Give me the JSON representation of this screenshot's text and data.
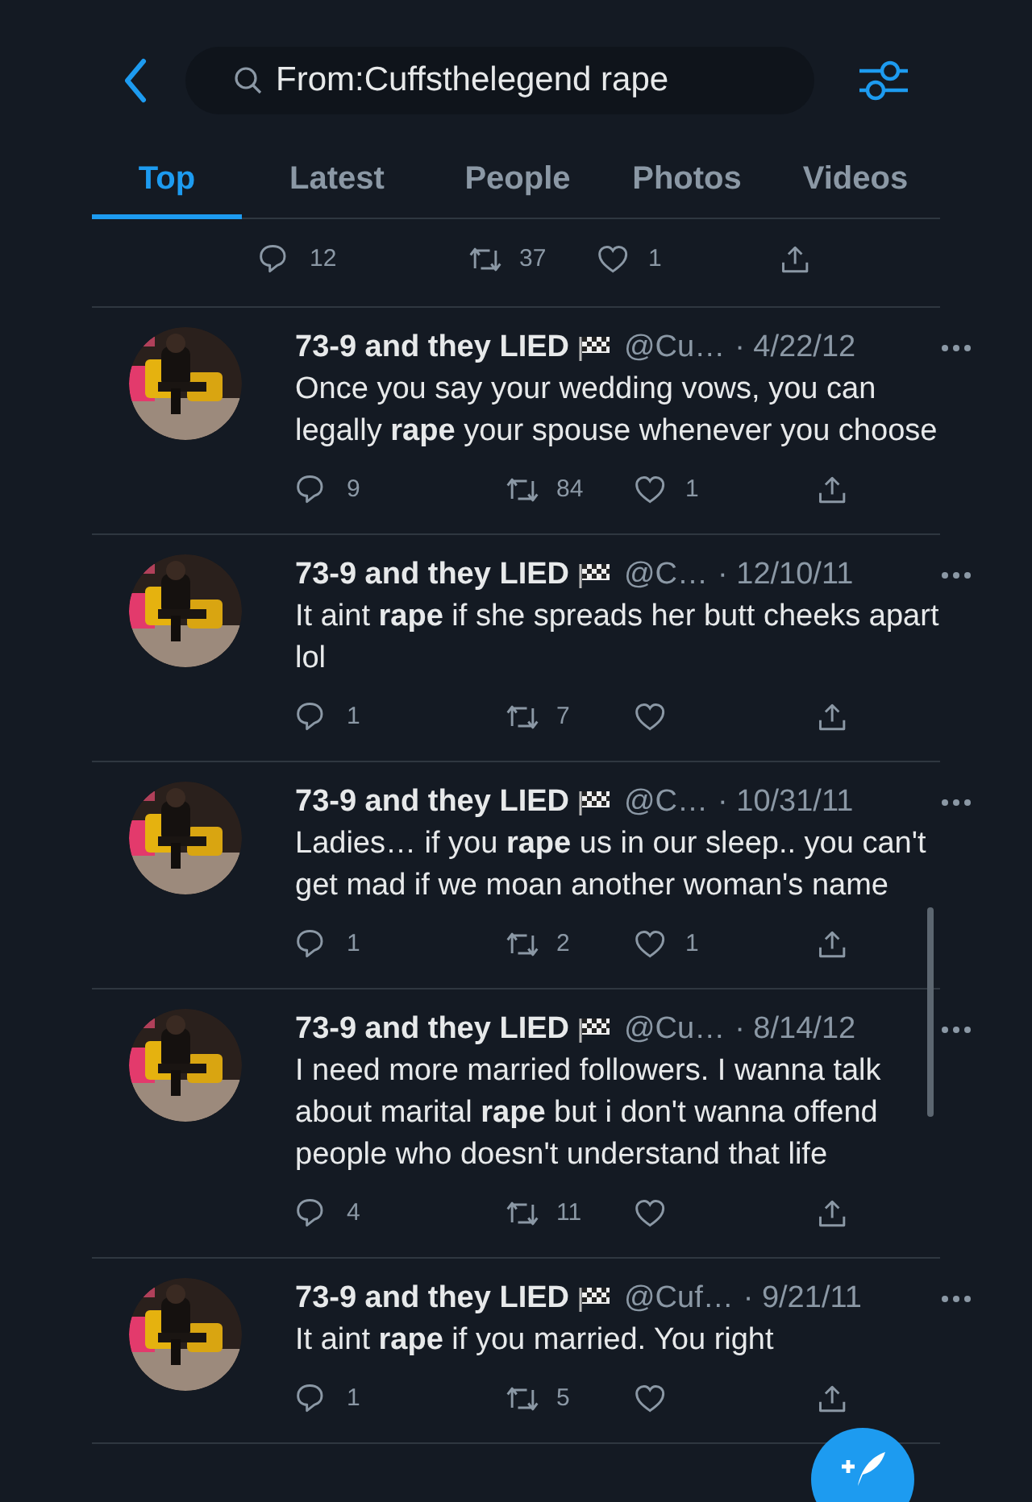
{
  "search": {
    "value": "From:Cuffsthelegend rape"
  },
  "tabs": [
    {
      "label": "Top",
      "selected": true
    },
    {
      "label": "Latest",
      "selected": false
    },
    {
      "label": "People",
      "selected": false
    },
    {
      "label": "Photos",
      "selected": false
    },
    {
      "label": "Videos",
      "selected": false
    }
  ],
  "partial_tweet": {
    "replies": "12",
    "retweets": "37",
    "likes": "1"
  },
  "tweets": [
    {
      "name": "73-9 and they LIED",
      "handle": "@Cu…",
      "date": "· 4/22/12",
      "text": "Once you say your wedding vows, you can legally **rape** your spouse whenever you choose",
      "replies": "9",
      "retweets": "84",
      "likes": "1"
    },
    {
      "name": "73-9 and they LIED",
      "handle": "@C…",
      "date": "· 12/10/11",
      "text": "It aint **rape** if she spreads her butt cheeks apart lol",
      "replies": "1",
      "retweets": "7"
    },
    {
      "name": "73-9 and they LIED",
      "handle": "@C…",
      "date": "· 10/31/11",
      "text": "Ladies… if you **rape** us in our sleep.. you can't get mad if we moan another woman's name",
      "replies": "1",
      "retweets": "2",
      "likes": "1"
    },
    {
      "name": "73-9 and they LIED",
      "handle": "@Cu…",
      "date": "· 8/14/12",
      "text": "I need more married followers. I wanna talk about marital **rape** but i don't wanna offend people who doesn't understand that life",
      "replies": "4",
      "retweets": "11"
    },
    {
      "name": "73-9 and they LIED",
      "handle": "@Cuf…",
      "date": "· 9/21/11",
      "text": "It aint **rape** if you married. You right",
      "replies": "1",
      "retweets": "5"
    }
  ]
}
